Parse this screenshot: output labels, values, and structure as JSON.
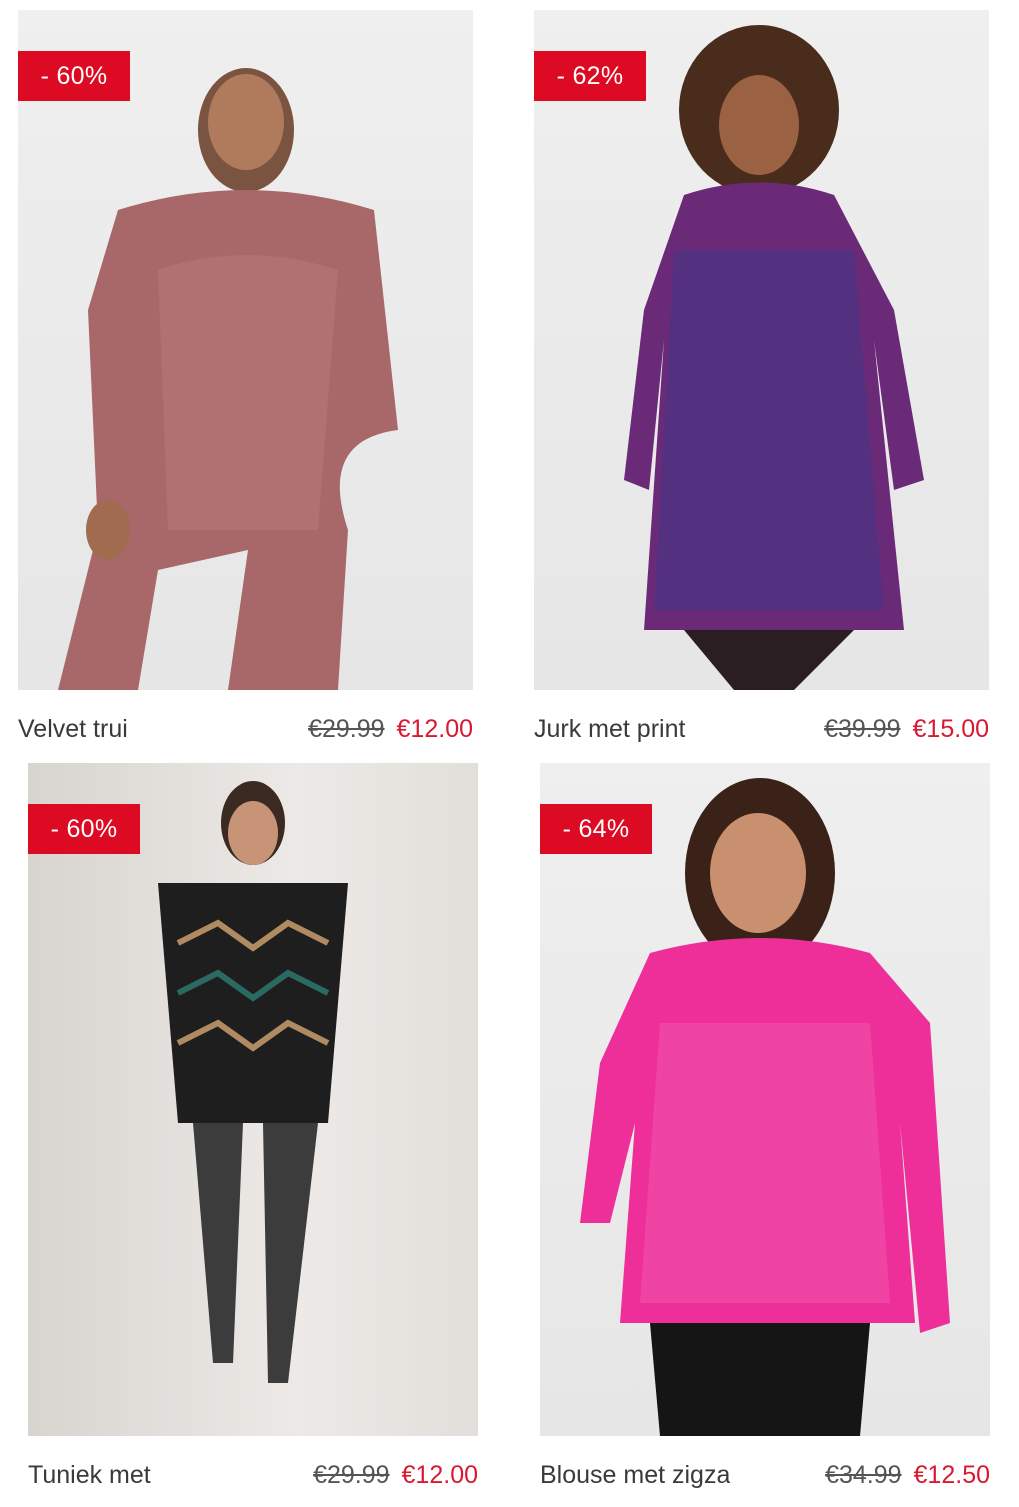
{
  "colors": {
    "badge_bg": "#dc0a23",
    "sale_price": "#d8192f",
    "name_text": "#3a3a3a"
  },
  "products": [
    {
      "badge": "- 60%",
      "name": "Velvet trui",
      "old_price": "€29.99",
      "new_price": "€12.00",
      "image": "model-velvet-sweater-photo"
    },
    {
      "badge": "- 62%",
      "name": "Jurk met print",
      "old_price": "€39.99",
      "new_price": "€15.00",
      "image": "model-printed-dress-photo"
    },
    {
      "badge": "- 60%",
      "name": "Tuniek met",
      "old_price": "€29.99",
      "new_price": "€12.00",
      "image": "model-sequin-tunic-photo"
    },
    {
      "badge": "- 64%",
      "name": "Blouse met zigza",
      "old_price": "€34.99",
      "new_price": "€12.50",
      "image": "model-pink-blouse-photo"
    }
  ]
}
